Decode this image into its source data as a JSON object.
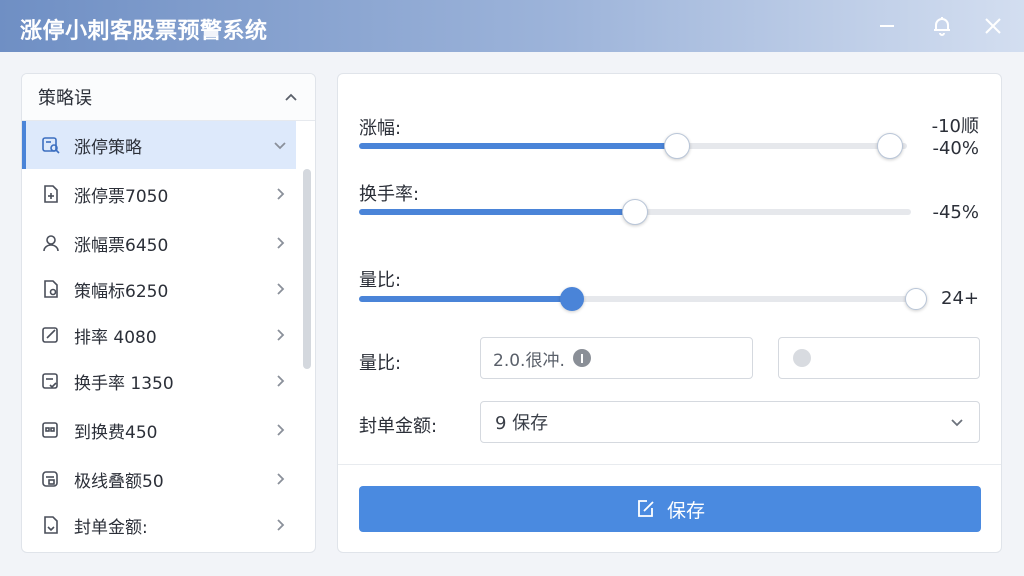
{
  "window": {
    "title": "涨停小刺客股票预警系统"
  },
  "sidebar": {
    "header": "策略误",
    "items": [
      {
        "label": "涨停策略",
        "icon": "search-doc-icon",
        "active": true
      },
      {
        "label": "涨停票7050",
        "icon": "doc-plus-icon"
      },
      {
        "label": "涨幅票6450",
        "icon": "user-icon"
      },
      {
        "label": "策幅标6250",
        "icon": "doc-lock-icon"
      },
      {
        "label": "排率 4080",
        "icon": "edit-icon"
      },
      {
        "label": "换手率 1350",
        "icon": "doc-check-icon"
      },
      {
        "label": "到换费450",
        "icon": "grid-doc-icon"
      },
      {
        "label": "极线叠额50",
        "icon": "doc-gear-icon"
      },
      {
        "label": "封单金额:",
        "icon": "doc-arrow-icon"
      }
    ]
  },
  "main": {
    "slider1": {
      "label": "涨幅:",
      "top_value": "-10顺",
      "value": "-40%",
      "fill": 0.58
    },
    "slider2": {
      "label": "换手率:",
      "value": "-45%",
      "fill": 0.5
    },
    "slider3": {
      "label": "量比:",
      "value": "24+",
      "fill": 0.38
    },
    "input_row": {
      "label": "量比:",
      "input_value": "2.0.很冲."
    },
    "select_row": {
      "label": "封单金额:",
      "selected": "9 保存"
    },
    "save_label": "保存"
  },
  "colors": {
    "accent": "#4a84d8",
    "titlebar": "#6f8fc4"
  }
}
